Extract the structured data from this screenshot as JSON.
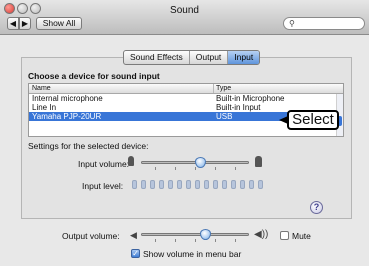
{
  "window": {
    "title": "Sound",
    "show_all": "Show All",
    "nav_back": "◀",
    "nav_forward": "▶",
    "search_icon": "🔍"
  },
  "tabs": [
    {
      "label": "Sound Effects",
      "active": false
    },
    {
      "label": "Output",
      "active": false
    },
    {
      "label": "Input",
      "active": true
    }
  ],
  "input": {
    "choose_label": "Choose a device for sound input",
    "columns": {
      "name": "Name",
      "type": "Type"
    },
    "devices": [
      {
        "name": "Internal microphone",
        "type": "Built-in Microphone"
      },
      {
        "name": "Line In",
        "type": "Built-in Input"
      },
      {
        "name": "Yamaha PJP-20UR",
        "type": "USB"
      }
    ],
    "selected_index": 2,
    "callout": "Select",
    "settings_label": "Settings for the selected device:",
    "input_volume_label": "Input volume:",
    "input_volume_level": 0.55,
    "input_level_label": "Input level:",
    "input_level_segments": 15,
    "help_icon": "?"
  },
  "output": {
    "output_volume_label": "Output volume:",
    "output_volume_level": 0.6,
    "mute_label": "Mute",
    "mute_checked": false,
    "show_in_menu_label": "Show volume in menu bar",
    "show_in_menu_checked": true
  },
  "colors": {
    "selection": "#3875d7",
    "accent": "#5f95dc"
  }
}
